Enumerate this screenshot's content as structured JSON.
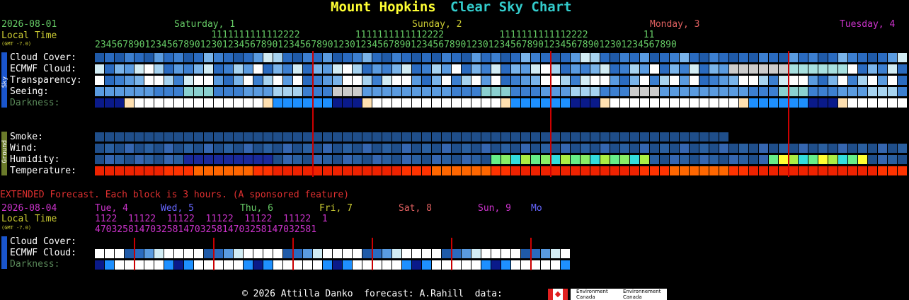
{
  "title": {
    "part1": "Mount Hopkins",
    "part2": "Clear Sky Chart"
  },
  "date": "2026-08-01",
  "local_time": "Local Time",
  "gmt": "(GMT -7.0)",
  "days": [
    {
      "label": "Saturday, 1",
      "color": "#66cc66"
    },
    {
      "label": "Sunday, 2",
      "color": "#cccc33"
    },
    {
      "label": "Monday, 3",
      "color": "#e06060"
    },
    {
      "label": "Tuesday, 4",
      "color": "#cc33cc"
    }
  ],
  "hours_top": "                     1111111111112222          1111111111112222          1111111111112222          11",
  "hours_bottom": "234567890123456789012301234567890123456789012301234567890123456789012301234567890123456789012301234567890",
  "side_labels": {
    "sky": "Sky",
    "ground": "Ground"
  },
  "rows_sky": [
    "Cloud Cover:",
    "ECMWF Cloud:",
    "Transparency:",
    "Seeing:",
    "Darkness:"
  ],
  "rows_ground": [
    "Smoke:",
    "Wind:",
    "Humidity:",
    "Temperature:"
  ],
  "extended": {
    "note": "EXTENDED Forecast. Each block is 3 hours. (A sponsored feature)",
    "date": "2026-08-04",
    "local_time": "Local Time",
    "gmt": "(GMT -7.0)",
    "days": [
      {
        "label": "Tue, 4",
        "color": "#cc33cc"
      },
      {
        "label": "Wed, 5",
        "color": "#6666ff"
      },
      {
        "label": "Thu, 6",
        "color": "#66cc66"
      },
      {
        "label": "Fri, 7",
        "color": "#cccc33"
      },
      {
        "label": "Sat, 8",
        "color": "#e06060"
      },
      {
        "label": "Sun, 9",
        "color": "#cc33cc"
      },
      {
        "label": "Mo",
        "color": "#6666ff"
      }
    ],
    "hours_top": "1122  11122  11122  11122  11122  11122  1",
    "hours_bottom": "4703258147032581470325814703258147032581",
    "rows": [
      "Cloud Cover:",
      "ECMWF Cloud:",
      "Darkness:"
    ]
  },
  "footer": {
    "text": "© 2026 Attilla Danko  forecast: A.Rahill  data:",
    "env1": "Environment Canada",
    "env2": "Environnement Canada"
  }
}
